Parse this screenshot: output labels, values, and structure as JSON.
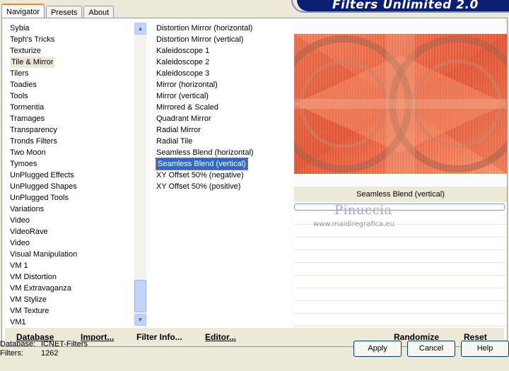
{
  "tabs": [
    "Navigator",
    "Presets",
    "About"
  ],
  "brand": "Filters Unlimited 2.0",
  "categories": [
    "Sybia",
    "Teph's Tricks",
    "Texturize",
    "Tile & Mirror",
    "Tilers",
    "Toadies",
    "Tools",
    "Tormentia",
    "Tramages",
    "Transparency",
    "Tronds Filters",
    "Two Moon",
    "Tymoes",
    "UnPlugged Effects",
    "UnPlugged Shapes",
    "UnPlugged Tools",
    "Variations",
    "Video",
    "VideoRave",
    "Video",
    "Visual Manipulation",
    "VM 1",
    "VM Distortion",
    "VM Extravaganza",
    "VM Stylize",
    "VM Texture",
    "VM1"
  ],
  "selected_category_index": 3,
  "filters": [
    "Distortion Mirror (horizontal)",
    "Distortion Mirror (vertical)",
    "Kaleidoscope 1",
    "Kaleidoscope 2",
    "Kaleidoscope 3",
    "Mirror (horizontal)",
    "Mirror (vertical)",
    "Mirrored & Scaled",
    "Quadrant Mirror",
    "Radial Mirror",
    "Radial Tile",
    "Seamless Blend (horizontal)",
    "Seamless Blend (vertical)",
    "XY Offset 50% (negative)",
    "XY Offset 50% (positive)"
  ],
  "selected_filter_index": 12,
  "preview": {
    "filter_name": "Seamless Blend (vertical)"
  },
  "watermark": {
    "name": "Pinuccia",
    "url": "www.maidiregrafica.eu"
  },
  "buttons": {
    "database": "Database",
    "import": "Import...",
    "filter_info": "Filter Info...",
    "editor": "Editor...",
    "randomize": "Randomize",
    "reset": "Reset",
    "apply": "Apply",
    "cancel": "Cancel",
    "help": "Help"
  },
  "status": {
    "database_label": "Database:",
    "database_value": "ICNET-Filters",
    "filters_label": "Filters:",
    "filters_value": "1262"
  },
  "colors": {
    "selection": "#316ac5",
    "brand_bg": "#0a1e74",
    "preview_main": "#e8663f"
  }
}
